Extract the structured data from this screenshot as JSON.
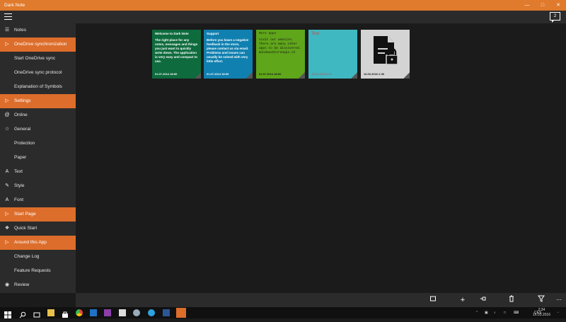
{
  "window": {
    "title": "Dark Note",
    "controls": [
      "minimize-icon",
      "maximize-icon",
      "close-icon"
    ]
  },
  "appbar": {
    "menu_icon": "hamburger-menu-icon",
    "badge_count": "2"
  },
  "sidebar": {
    "items": [
      {
        "label": "Notes",
        "icon": "notes-icon",
        "section": false
      },
      {
        "label": "OneDrive synchronization",
        "icon": "chevron-right-icon",
        "section": true
      },
      {
        "label": "Start OneDrive sync",
        "icon": "",
        "section": false
      },
      {
        "label": "OneDrive sync protocol",
        "icon": "",
        "section": false
      },
      {
        "label": "Explanation of Symbols",
        "icon": "",
        "section": false
      },
      {
        "label": "Settings",
        "icon": "chevron-right-icon",
        "section": true
      },
      {
        "label": "Online",
        "icon": "at-icon",
        "section": false
      },
      {
        "label": "General",
        "icon": "star-icon",
        "section": false
      },
      {
        "label": "Protection",
        "icon": "",
        "section": false
      },
      {
        "label": "Paper",
        "icon": "",
        "section": false
      },
      {
        "label": "Text",
        "icon": "text-icon",
        "section": false
      },
      {
        "label": "Style",
        "icon": "style-icon",
        "section": false
      },
      {
        "label": "Font",
        "icon": "font-icon",
        "section": false
      },
      {
        "label": "Start Page",
        "icon": "chevron-right-icon",
        "section": true
      },
      {
        "label": "Quick Start",
        "icon": "quick-start-icon",
        "section": false
      },
      {
        "label": "Around this App",
        "icon": "chevron-right-icon",
        "section": true
      },
      {
        "label": "Change Log",
        "icon": "",
        "section": false
      },
      {
        "label": "Feature Requests",
        "icon": "",
        "section": false
      },
      {
        "label": "Review",
        "icon": "globe-icon",
        "section": false
      }
    ]
  },
  "notes": [
    {
      "title": "Welcome to Dark Note",
      "body": "The right place for any notes, messages and things you just want to quickly write down. The application is very easy and compact to use.",
      "date": "01.07.2014 18:00",
      "bg": "#0e6b3d",
      "fg": "#ffffff",
      "mono": false
    },
    {
      "title": "Support",
      "body": "Before you leave a negative feedback in the store, please contact us via email. Problems and issues can usually be solved with very little effort.",
      "date": "01.07.2014 18:00",
      "bg": "#1080b0",
      "fg": "#ffffff",
      "mono": false
    },
    {
      "title": "More apps",
      "body": "Visit our website. There are many other apps to be discovered. WindowsStoreApps.ch",
      "date": "01.07.2014 18:00",
      "bg": "#5fa61a",
      "fg": "#1a1a1a",
      "mono": true
    },
    {
      "title": "Test",
      "body": "",
      "date": "16.03.2016 2:24",
      "bg": "#3fb8c2",
      "fg": "#c84a4a",
      "mono": false
    },
    {
      "title": "",
      "body": "",
      "date": "16.03.2016 2:30",
      "bg": "#d4d4d4",
      "fg": "#1a1a1a",
      "mono": false,
      "icon": "locked-document-icon"
    }
  ],
  "bottombar": {
    "buttons": [
      "select-icon",
      "add-icon",
      "pin-icon",
      "delete-icon",
      "filter-icon",
      "more-icon"
    ]
  },
  "taskbar": {
    "apps": [
      "windows-start-icon",
      "search-icon",
      "task-view-icon",
      "file-explorer-icon",
      "store-icon",
      "chrome-icon",
      "outlook-icon",
      "onenote-icon",
      "calculator-icon",
      "app-icon",
      "skype-icon",
      "word-icon",
      "dark-note-icon"
    ],
    "tray": [
      "up-arrow-icon",
      "network-icon",
      "volume-icon",
      "message-icon",
      "keyboard-icon"
    ],
    "language": "CES",
    "time": "2:34",
    "date": "16.03.2016"
  },
  "colors": {
    "accent": "#dd6d2b",
    "titlebar": "#e07a2c",
    "sidebar": "#2b2b2b",
    "background": "#1b1b1b"
  }
}
